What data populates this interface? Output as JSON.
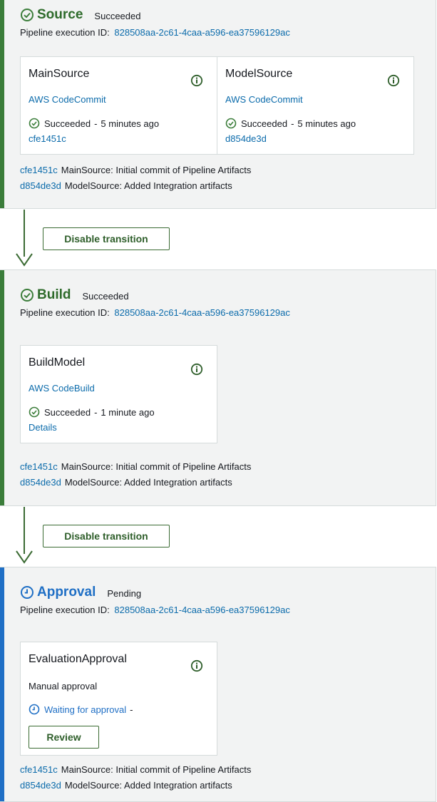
{
  "execution_id_label": "Pipeline execution ID:",
  "execution_id": "828508aa-2c61-4caa-a596-ea37596129ac",
  "colors": {
    "success": "#3b7d3a",
    "pending": "#1f6fc5",
    "link": "#0b6bab"
  },
  "stages": [
    {
      "name": "Source",
      "status": "Succeeded",
      "icon": "check-circle-icon",
      "actions": [
        {
          "name": "MainSource",
          "provider": "AWS CodeCommit",
          "status": "Succeeded",
          "sep": "-",
          "time": "5 minutes ago",
          "link": "cfe1451c"
        },
        {
          "name": "ModelSource",
          "provider": "AWS CodeCommit",
          "status": "Succeeded",
          "sep": "-",
          "time": "5 minutes ago",
          "link": "d854de3d"
        }
      ],
      "commits": [
        {
          "id": "cfe1451c",
          "message": "MainSource: Initial commit of Pipeline Artifacts"
        },
        {
          "id": "d854de3d",
          "message": "ModelSource: Added Integration artifacts"
        }
      ]
    },
    {
      "name": "Build",
      "status": "Succeeded",
      "icon": "check-circle-icon",
      "actions": [
        {
          "name": "BuildModel",
          "provider": "AWS CodeBuild",
          "status": "Succeeded",
          "sep": "-",
          "time": "1 minute ago",
          "link": "Details"
        }
      ],
      "commits": [
        {
          "id": "cfe1451c",
          "message": "MainSource: Initial commit of Pipeline Artifacts"
        },
        {
          "id": "d854de3d",
          "message": "ModelSource: Added Integration artifacts"
        }
      ]
    },
    {
      "name": "Approval",
      "status": "Pending",
      "icon": "clock-icon",
      "actions": [
        {
          "name": "EvaluationApproval",
          "provider": "Manual approval",
          "status": "Waiting for approval",
          "sep": "-",
          "button": "Review"
        }
      ],
      "commits": [
        {
          "id": "cfe1451c",
          "message": "MainSource: Initial commit of Pipeline Artifacts"
        },
        {
          "id": "d854de3d",
          "message": "ModelSource: Added Integration artifacts"
        }
      ]
    }
  ],
  "transitions": [
    {
      "label": "Disable transition"
    },
    {
      "label": "Disable transition"
    }
  ]
}
